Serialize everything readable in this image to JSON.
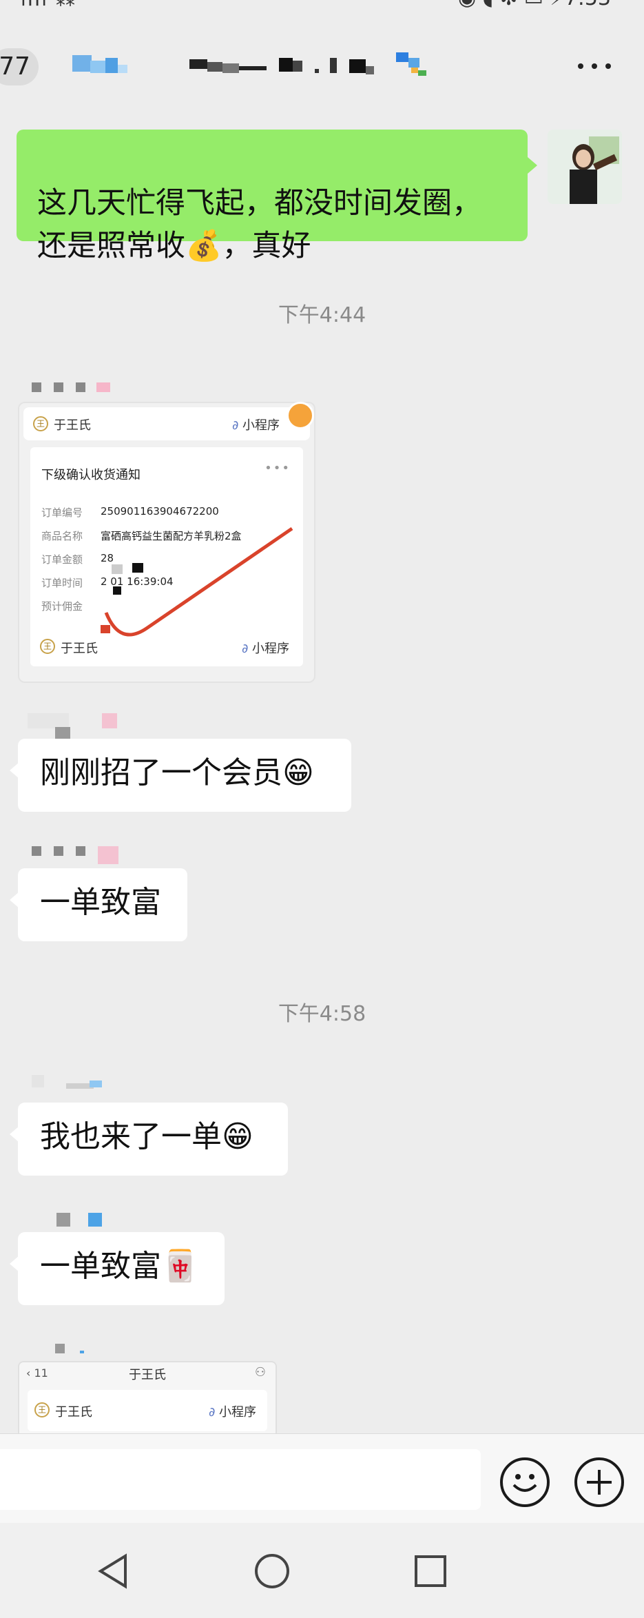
{
  "header": {
    "unread_count": "77",
    "more_icon": "more-dots-icon"
  },
  "messages": {
    "self_text": "这几天忙得飞起，都没时间发圈，\n还是照常收💰，真好",
    "time_1": "下午4:44",
    "card": {
      "brand": "于王氏",
      "tag": "小程序",
      "title": "下级确认收货通知",
      "rows": [
        {
          "label": "订单编号",
          "value": "2509011639​04672200"
        },
        {
          "label": "商品名称",
          "value": "富硒高钙益生菌配方羊乳粉2盒"
        },
        {
          "label": "订单金额",
          "value": "28"
        },
        {
          "label": "订单时间",
          "value": "2         01 16:39:04"
        },
        {
          "label": "预计佣金",
          "value": ""
        }
      ],
      "footer_brand": "于王氏",
      "footer_tag": "小程序"
    },
    "msg_1": "刚刚招了一个会员😁",
    "msg_2": "一单致富",
    "time_2": "下午4:58",
    "msg_3": "我也来了一单😁",
    "msg_4": "一单致富🀄",
    "card2": {
      "nav_title": "于王氏",
      "brand": "于王氏",
      "tag": "小程序"
    }
  },
  "input": {
    "emoji_icon": "emoji-face-icon",
    "plus_icon": "plus-circle-icon"
  },
  "nav": {
    "back": "nav-back-triangle-icon",
    "home": "nav-home-circle-icon",
    "recent": "nav-recent-square-icon"
  },
  "colors": {
    "background": "#ededed",
    "self_bubble": "#95ec69",
    "other_bubble": "#ffffff",
    "accent_line": "#d9432b"
  }
}
